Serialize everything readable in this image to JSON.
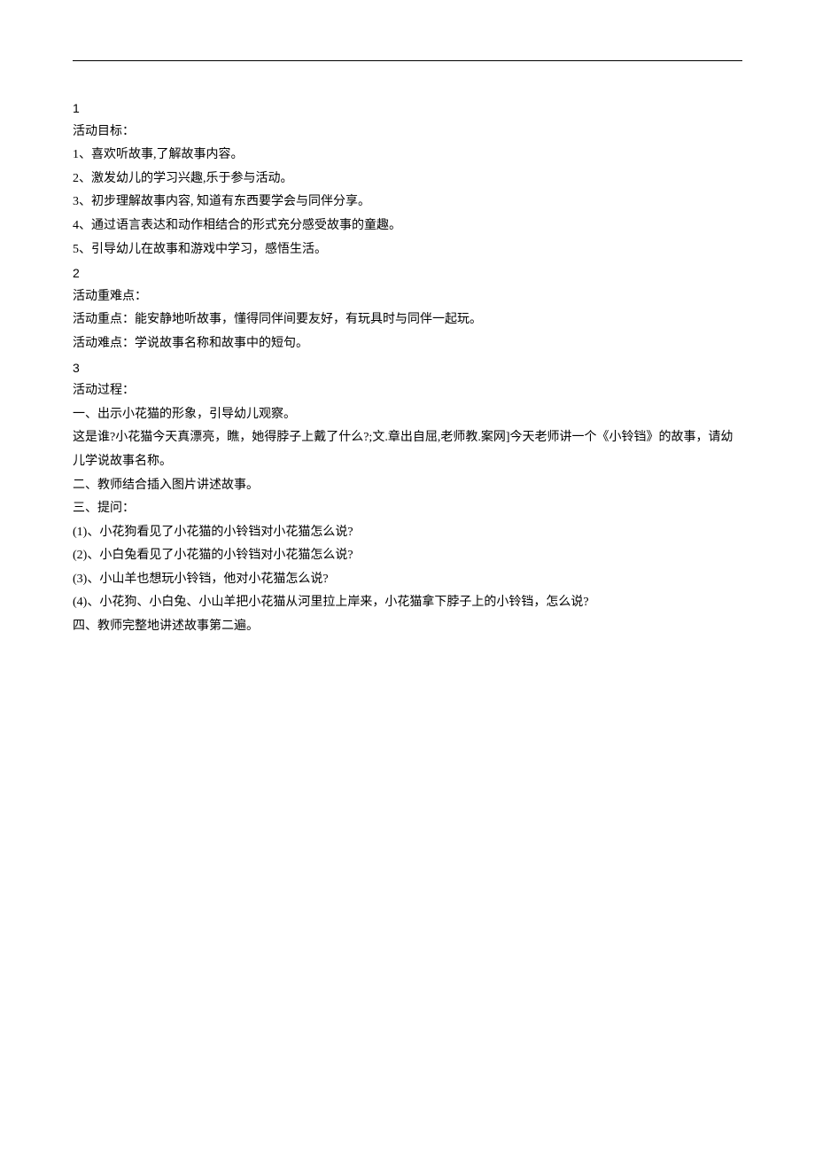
{
  "sections": [
    {
      "num": "1",
      "heading": "活动目标：",
      "lines": [
        "1、喜欢听故事,了解故事内容。",
        "2、激发幼儿的学习兴趣,乐于参与活动。",
        "3、初步理解故事内容, 知道有东西要学会与同伴分享。",
        "4、通过语言表达和动作相结合的形式充分感受故事的童趣。",
        "5、引导幼儿在故事和游戏中学习，感悟生活。"
      ]
    },
    {
      "num": "2",
      "heading": "活动重难点：",
      "lines": [
        "活动重点：能安静地听故事，懂得同伴间要友好，有玩具时与同伴一起玩。",
        "活动难点：学说故事名称和故事中的短句。"
      ]
    },
    {
      "num": "3",
      "heading": "活动过程：",
      "lines": [
        "一、出示小花猫的形象，引导幼儿观察。",
        "这是谁?小花猫今天真漂亮，瞧，她得脖子上戴了什么?;文.章出自屈,老师教.案网]今天老师讲一个《小铃铛》的故事，请幼儿学说故事名称。",
        "二、教师结合插入图片讲述故事。",
        "三、提问：",
        "(1)、小花狗看见了小花猫的小铃铛对小花猫怎么说?",
        "(2)、小白兔看见了小花猫的小铃铛对小花猫怎么说?",
        "(3)、小山羊也想玩小铃铛，他对小花猫怎么说?",
        "(4)、小花狗、小白兔、小山羊把小花猫从河里拉上岸来，小花猫拿下脖子上的小铃铛，怎么说?",
        "四、教师完整地讲述故事第二遍。"
      ]
    }
  ]
}
